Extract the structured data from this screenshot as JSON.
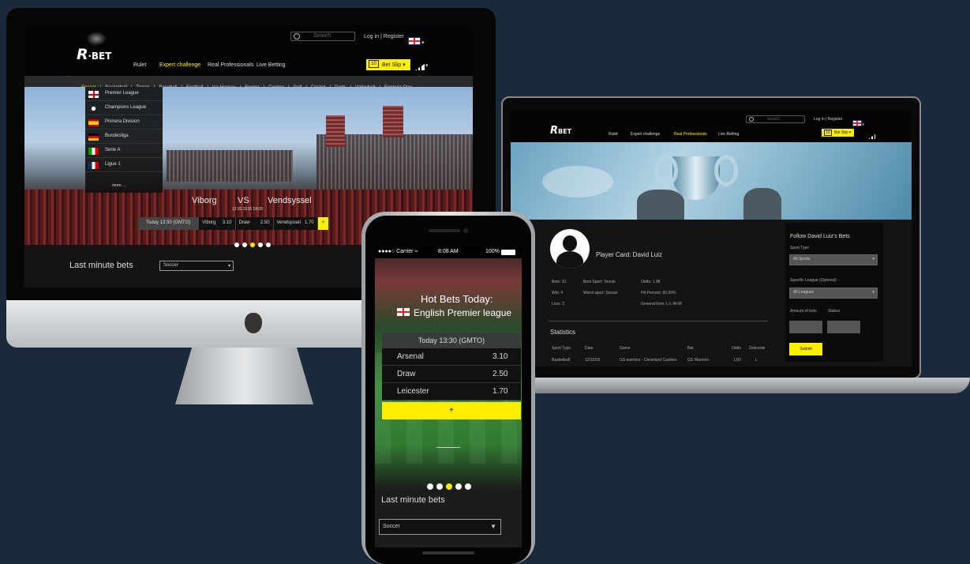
{
  "desktop": {
    "search_placeholder": "Search",
    "login": "Log in",
    "register": "Register",
    "nav": [
      "Rulet",
      "Expert challenge",
      "Real Professionals",
      "Live Betting"
    ],
    "nav_active": 1,
    "bet_slip": "Bet Slip",
    "sports": [
      "Soccer",
      "Basketball",
      "Tennis",
      "Baseball",
      "Football",
      "Ice Hockey",
      "Boxing",
      "Cycling",
      "Golf",
      "Cricket",
      "Darts",
      "Volleyball",
      "Formula One"
    ],
    "sports_active": 0,
    "leagues": [
      "Premier League",
      "Champions League",
      "Primera Division",
      "Bundesliga",
      "Serie A",
      "Ligue 1"
    ],
    "leagues_more": "more ...",
    "match": {
      "home": "Viborg",
      "vs": "VS",
      "away": "Vendsyssel",
      "datetime": "12.02.2016 18:00"
    },
    "odds": {
      "time": "Today 13:30 (GMTO)",
      "home": "Viborg",
      "home_odd": "3.10",
      "draw": "Draw",
      "draw_odd": "2.50",
      "away": "Vendsyssel",
      "away_odd": "1.70",
      "plus": "+"
    },
    "last_minute": "Last minute bets",
    "sport_select": "Soccer",
    "brand": "R",
    "brand_suffix": "BET"
  },
  "laptop": {
    "search_placeholder": "Search",
    "login": "Log in",
    "register": "Register",
    "nav": [
      "Rulet",
      "Expert challenge",
      "Real Professionals",
      "Live Betting"
    ],
    "nav_active": 2,
    "bet_slip": "Bet Slip",
    "player_card": "Player Card: David Luiz",
    "stats_left": [
      "Bets: 31",
      "Win: 4",
      "Loss: 2"
    ],
    "stats_mid": [
      "Best Sport: Tennis",
      "Worst sport: Soccer"
    ],
    "stats_right": [
      "Odds: 1.98",
      "Hit Percent: 60.00%",
      "General form: L-L-W-W"
    ],
    "statistics": "Statistics",
    "table_headers": [
      "Sport Type",
      "Date",
      "Game",
      "Bet",
      "Odds",
      "Outcome"
    ],
    "table_row": [
      "Basketball",
      "12/10/16",
      "GS warriors - Cleveland Cavliers",
      "GS Warriors",
      "1.60",
      "L"
    ],
    "follow_title": "Follow  David Luiz's Bets",
    "sport_type_label": "Sport Type",
    "sport_type_value": "All Sports",
    "league_label": "Specific League (Optional)",
    "league_value": "All Leagues",
    "amount_label": "Amount of bets",
    "stakes_label": "Stakes",
    "submit": "Submit",
    "brand": "R",
    "brand_suffix": "BET"
  },
  "phone": {
    "carrier": "Carrier",
    "time": "8:08 AM",
    "battery": "100%",
    "hot_bets": "Hot Bets Today:",
    "league": "English Premier league",
    "time_header": "Today 13:30 (GMTO)",
    "rows": [
      {
        "team": "Arsenal",
        "odd": "3.10"
      },
      {
        "team": "Draw",
        "odd": "2.50"
      },
      {
        "team": "Leicester",
        "odd": "1.70"
      }
    ],
    "plus": "+",
    "last_minute": "Last minute bets",
    "sport_select": "Soccer"
  },
  "colors": {
    "accent": "#ffee00",
    "background": "#1b2a3a"
  }
}
